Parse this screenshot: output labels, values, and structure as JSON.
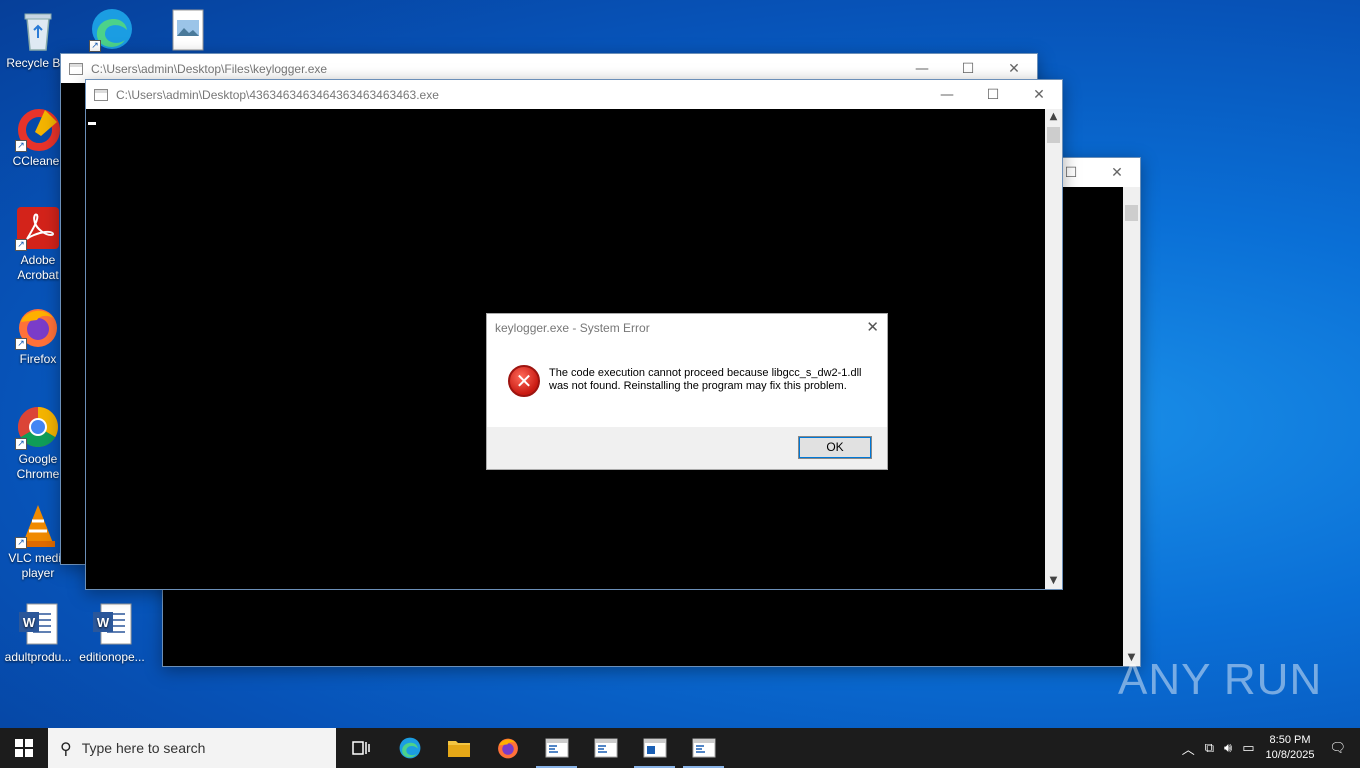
{
  "desktop": {
    "icons": [
      {
        "label": "Recycle Bin",
        "icon": "recycle-bin-icon"
      },
      {
        "label": "CCleaner",
        "icon": "ccleaner-icon"
      },
      {
        "label": "Adobe Acrobat",
        "icon": "acrobat-icon"
      },
      {
        "label": "Firefox",
        "icon": "firefox-icon"
      },
      {
        "label": "Google Chrome",
        "icon": "chrome-icon"
      },
      {
        "label": "VLC media player",
        "icon": "vlc-icon"
      },
      {
        "label": "adultprodu...",
        "icon": "word-doc-icon"
      },
      {
        "label": "editionope...",
        "icon": "word-doc-icon"
      }
    ]
  },
  "windows": {
    "back": {
      "title": "C:\\Users\\admin\\Desktop\\Files\\keylogger.exe"
    },
    "front": {
      "title": "C:\\Users\\admin\\Desktop\\4363463463464363463463463.exe"
    }
  },
  "dialog": {
    "title": "keylogger.exe - System Error",
    "message": "The code execution cannot proceed because libgcc_s_dw2-1.dll was not found. Reinstalling the program may fix this problem.",
    "ok_label": "OK"
  },
  "taskbar": {
    "search_placeholder": "Type here to search",
    "time": "8:50 PM",
    "date": "10/8/2025"
  },
  "watermark": "ANY RUN",
  "colors": {
    "desktop": "#0a6fd6",
    "taskbar": "#1c1c1c",
    "error": "#c91a12"
  }
}
